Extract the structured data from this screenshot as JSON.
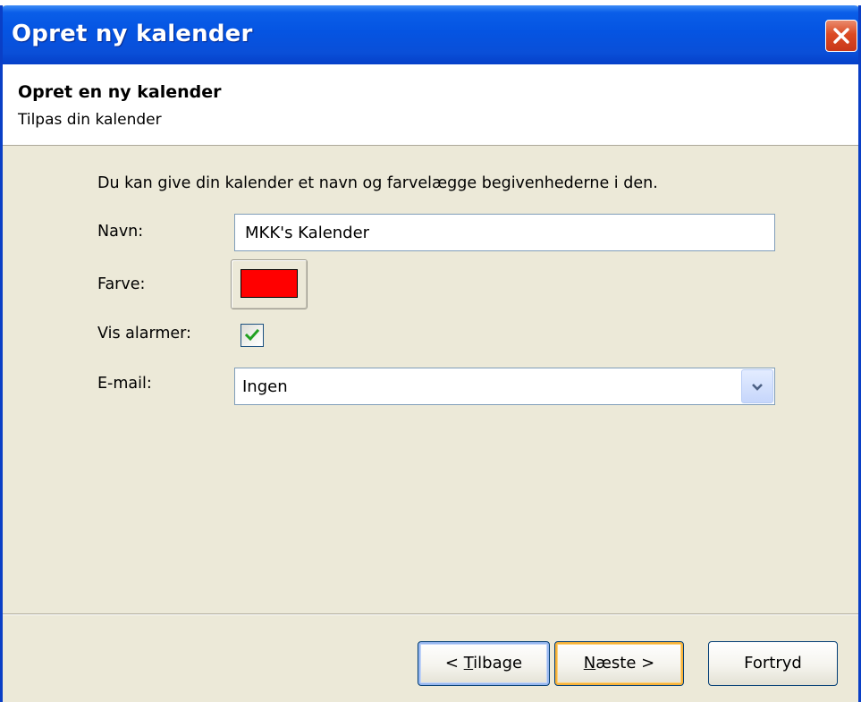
{
  "window": {
    "title": "Opret ny kalender"
  },
  "header": {
    "title": "Opret en ny kalender",
    "subtitle": "Tilpas din kalender"
  },
  "form": {
    "intro": "Du kan give din kalender et navn og farvelægge begivenhederne i den.",
    "name_label": "Navn:",
    "name_value": "MKK's Kalender",
    "color_label": "Farve:",
    "color_value": "#ff0000",
    "alarms_label": "Vis alarmer:",
    "alarms_checked": true,
    "email_label": "E-mail:",
    "email_selected": "Ingen"
  },
  "buttons": {
    "back": {
      "label": "< Tilbage",
      "accel": "T"
    },
    "next": {
      "label": "Næste >",
      "accel": "N"
    },
    "cancel": {
      "label": "Fortryd"
    }
  },
  "colors": {
    "titlebar": "#0554e2",
    "dialog_bg": "#ece9d8",
    "close_red": "#db4a23"
  }
}
